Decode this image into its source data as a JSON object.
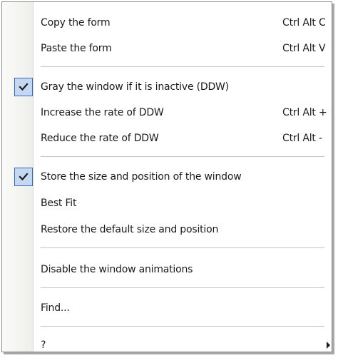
{
  "menu": {
    "items": [
      {
        "label": "Copy the form",
        "shortcut": "Ctrl Alt C",
        "checked": false
      },
      {
        "label": "Paste the form",
        "shortcut": "Ctrl Alt V",
        "checked": false
      },
      {
        "label": "Gray the window if it is inactive (DDW)",
        "shortcut": "",
        "checked": true
      },
      {
        "label": "Increase the rate of DDW",
        "shortcut": "Ctrl Alt +",
        "checked": false
      },
      {
        "label": "Reduce the rate of DDW",
        "shortcut": "Ctrl Alt -",
        "checked": false
      },
      {
        "label": "Store the size and position of the window",
        "shortcut": "",
        "checked": true
      },
      {
        "label": "Best Fit",
        "shortcut": "",
        "checked": false
      },
      {
        "label": "Restore the default size and position",
        "shortcut": "",
        "checked": false
      },
      {
        "label": "Disable the window animations",
        "shortcut": "",
        "checked": false
      },
      {
        "label": "Find...",
        "shortcut": "",
        "checked": false
      },
      {
        "label": "?",
        "shortcut": "",
        "checked": false,
        "submenu": true
      }
    ]
  },
  "colors": {
    "check_bg": "#c6d7f2",
    "check_border": "#316ac5",
    "separator": "#c5c5c5"
  },
  "icons": {
    "check": "checkmark-icon",
    "submenu": "submenu-arrow-icon"
  }
}
